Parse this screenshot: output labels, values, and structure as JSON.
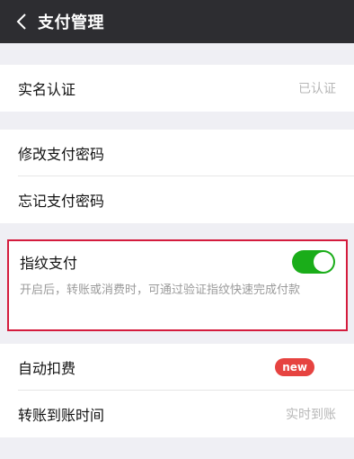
{
  "header": {
    "title": "支付管理"
  },
  "rows": {
    "real_name": {
      "label": "实名认证",
      "value": "已认证"
    },
    "modify_password": {
      "label": "修改支付密码"
    },
    "forgot_password": {
      "label": "忘记支付密码"
    },
    "fingerprint": {
      "label": "指纹支付",
      "enabled": true,
      "description": "开启后，转账或消费时，可通过验证指纹快速完成付款"
    },
    "auto_deduct": {
      "label": "自动扣费",
      "badge": "new"
    },
    "transfer_time": {
      "label": "转账到账时间",
      "value": "实时到账"
    }
  },
  "colors": {
    "topbar": "#2d2d31",
    "toggle_on": "#1aad19",
    "highlight_border": "#d41c3d",
    "badge": "#e64340"
  }
}
